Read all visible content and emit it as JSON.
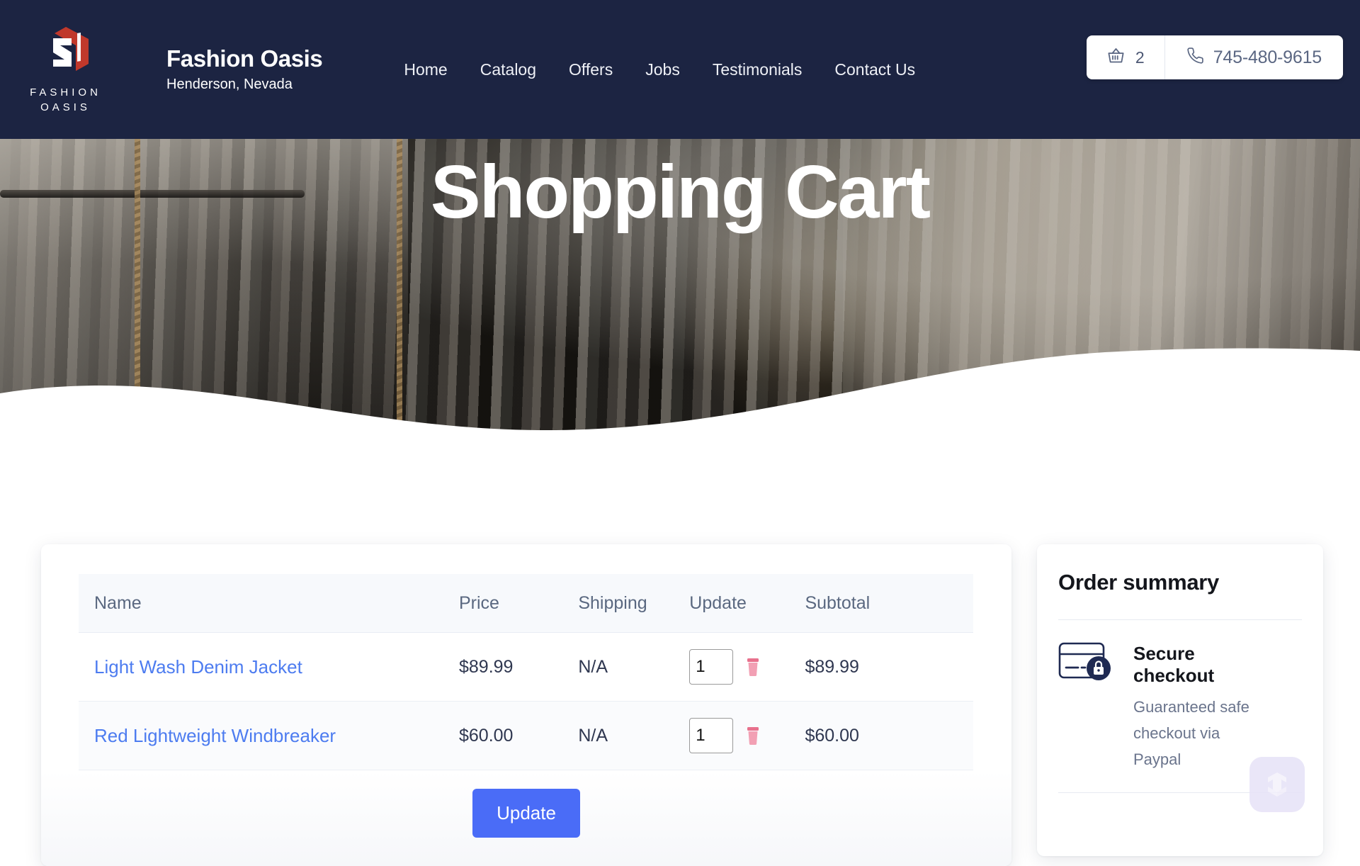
{
  "header": {
    "logo": {
      "icon": "fashion-oasis-cube-logo",
      "wordmark_line1": "FASHION",
      "wordmark_line2": "OASIS",
      "colors": {
        "white": "#ffffff",
        "red": "#c0382b"
      }
    },
    "brand_title": "Fashion Oasis",
    "brand_subtitle": "Henderson, Nevada",
    "nav_items": [
      {
        "label": "Home"
      },
      {
        "label": "Catalog"
      },
      {
        "label": "Offers"
      },
      {
        "label": "Jobs"
      },
      {
        "label": "Testimonials"
      },
      {
        "label": "Contact Us"
      }
    ],
    "cart": {
      "icon": "shopping-basket-icon",
      "count": "2"
    },
    "phone": {
      "icon": "phone-icon",
      "number": "745-480-9615"
    },
    "bar_color": "#1c2442"
  },
  "hero": {
    "title": "Shopping Cart",
    "image_alt": "clothing-rack-store-photo"
  },
  "cart": {
    "columns": [
      "Name",
      "Price",
      "Shipping",
      "Update",
      "Subtotal"
    ],
    "rows": [
      {
        "name": "Light Wash Denim Jacket",
        "price": "$89.99",
        "shipping": "N/A",
        "qty": "1",
        "subtotal": "$89.99"
      },
      {
        "name": "Red Lightweight Windbreaker",
        "price": "$60.00",
        "shipping": "N/A",
        "qty": "1",
        "subtotal": "$60.00"
      }
    ],
    "update_button": "Update",
    "link_color": "#4d7cf0",
    "button_color": "#4a6cf7",
    "trash_color": "#f2a0b4"
  },
  "order_summary": {
    "title": "Order summary",
    "secure": {
      "icon": "credit-card-lock-icon",
      "heading": "Secure checkout",
      "description": "Guaranteed safe checkout via Paypal"
    },
    "watermark_icon": "app-logo-watermark"
  }
}
